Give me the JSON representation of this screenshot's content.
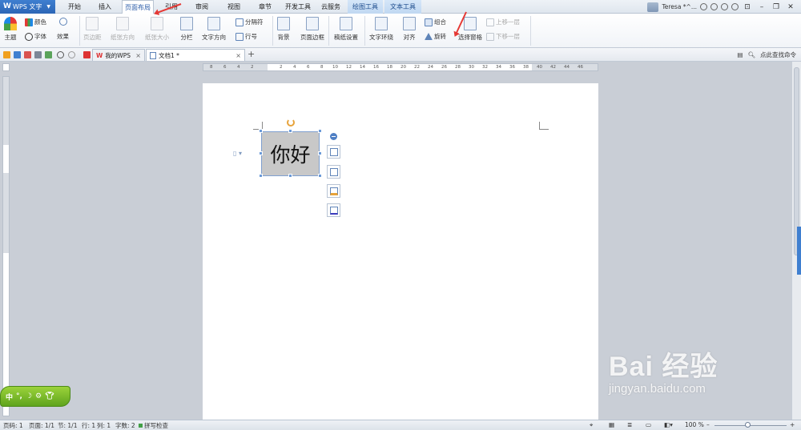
{
  "app": {
    "name": "WPS 文字"
  },
  "menu": {
    "tabs": [
      {
        "label": "开始"
      },
      {
        "label": "插入"
      },
      {
        "label": "页面布局"
      },
      {
        "label": "引用"
      },
      {
        "label": "审阅"
      },
      {
        "label": "视图"
      },
      {
        "label": "章节"
      },
      {
        "label": "开发工具"
      },
      {
        "label": "云服务"
      },
      {
        "label": "绘图工具"
      },
      {
        "label": "文本工具"
      }
    ],
    "active_tab": "页面布局"
  },
  "user": {
    "name": "Teresa *^..."
  },
  "ribbon": {
    "theme": "主题",
    "color": "颜色",
    "font": "字体",
    "effect": "效果",
    "margins": "页边距",
    "orientation": "纸张方向",
    "size": "纸张大小",
    "columns": "分栏",
    "text_direction": "文字方向",
    "breaks": "分隔符",
    "line_numbers": "行号",
    "background": "背景",
    "page_border": "页面边框",
    "paper_setup": "稿纸设置",
    "wrap_text": "文字环绕",
    "align": "对齐",
    "group": "组合",
    "rotate": "旋转",
    "selection_pane": "选择窗格",
    "bring_forward": "上移一层",
    "send_backward": "下移一层"
  },
  "doc_tabs": [
    {
      "label": "我的WPS"
    },
    {
      "label": "文档1 *"
    }
  ],
  "find_command": "点此查找命令",
  "ruler": {
    "h_numbers": [
      "8",
      "6",
      "4",
      "2",
      "2",
      "4",
      "6",
      "8",
      "10",
      "12",
      "14",
      "16",
      "18",
      "20",
      "22",
      "24",
      "26",
      "28",
      "30",
      "32",
      "34",
      "36",
      "38",
      "40",
      "42",
      "44",
      "46"
    ]
  },
  "document": {
    "textbox_text": "你好"
  },
  "ime": {
    "label": "中"
  },
  "status": {
    "page_num": "页码: 1",
    "pages": "页面: 1/1",
    "section": "节: 1/1",
    "row": "行: 1",
    "col": "列: 1",
    "words": "字数: 2",
    "spell": "拼写检查",
    "zoom": "100 %"
  },
  "watermark": {
    "brand": "Bai 经验",
    "url": "jingyan.baidu.com"
  },
  "colors": {
    "accent": "#2c66b6",
    "annotation": "#e53935",
    "ime_green": "#6fb82a"
  }
}
